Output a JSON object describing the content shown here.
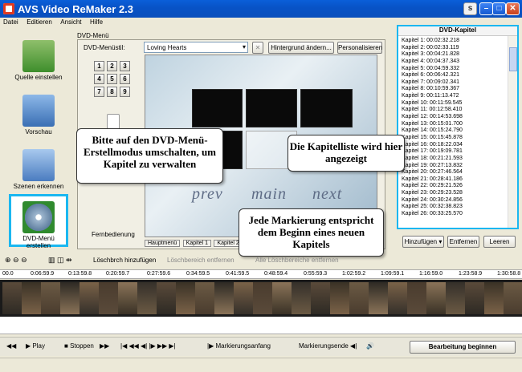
{
  "window": {
    "title": "AVS Video ReMaker 2.3"
  },
  "menu": [
    "Datei",
    "Editieren",
    "Ansicht",
    "Hilfe"
  ],
  "sidebar": {
    "items": [
      {
        "label": "Quelle einstellen"
      },
      {
        "label": "Vorschau"
      },
      {
        "label": "Szenen erkennen"
      },
      {
        "label": "DVD-Menü erstellen"
      }
    ]
  },
  "dvd_menu": {
    "section_label": "DVD-Menü",
    "style_label": "DVD-Menüstil:",
    "style_value": "Loving Hearts",
    "background_button": "Hintergrund ändern...",
    "personalize_button": "Personalisieren",
    "remote_label": "Fernbedienung",
    "numpad": [
      "1",
      "2",
      "3",
      "4",
      "5",
      "6",
      "7",
      "8",
      "9"
    ],
    "nav": [
      "prev",
      "main",
      "next"
    ],
    "tabs": [
      "Hauptmenü",
      "Kapitel 1",
      "Kapitel 2"
    ]
  },
  "chapters": {
    "title": "DVD-Kapitel",
    "items": [
      "Kapitel 1:   00:02:32.218",
      "Kapitel 2:   00:02:33.119",
      "Kapitel 3:   00:04:21.828",
      "Kapitel 4:   00:04:37.343",
      "Kapitel 5:   00:04:59.332",
      "Kapitel 6:   00:06:42.321",
      "Kapitel 7:   00:09:02.341",
      "Kapitel 8:   00:10:59.367",
      "Kapitel 9:   00:11:13.472",
      "Kapitel 10:  00:11:59.545",
      "Kapitel 11:  00:12:58.410",
      "Kapitel 12:  00:14:53.698",
      "Kapitel 13:  00:15:01.700",
      "Kapitel 14:  00:15:24.790",
      "Kapitel 15:  00:15:45.878",
      "Kapitel 16:  00:18:22.034",
      "Kapitel 17:  00:19:09.781",
      "Kapitel 18:  00:21:21.593",
      "Kapitel 19:  00:27:13.832",
      "Kapitel 20:  00:27:46.564",
      "Kapitel 21:  00:28:41.186",
      "Kapitel 22:  00:29:21.526",
      "Kapitel 23:  00:29:23.528",
      "Kapitel 24:  00:30:24.856",
      "Kapitel 25:  00:32:38.823",
      "Kapitel 26:  00:33:25.570"
    ],
    "add_button": "Hinzufügen",
    "remove_button": "Entfernen",
    "clear_button": "Leeren"
  },
  "callouts": {
    "menu_mode": "Bitte auf den DVD-Menü-Erstellmodus umschalten, um Kapitel zu verwalten",
    "chapter_list": "Die Kapitelliste wird hier angezeigt",
    "markers": "Jede Markierung entspricht dem Beginn eines neuen Kapitels"
  },
  "timeline": {
    "add_cut_button": "Löschbrch hinzufügen",
    "remove_cut_button": "Löschbereich entfernen",
    "remove_all_button": "Alle Löschbereiche entfernen",
    "ruler": [
      "00.0",
      "0:06:59.9",
      "0:13:59.8",
      "0:20:59.7",
      "0:27:59.6",
      "0:34:59.5",
      "0:41:59.5",
      "0:48:59.4",
      "0:55:59.3",
      "1:02:59.2",
      "1:09:59.1",
      "1:16:59.0",
      "1:23:58.9",
      "1:30:58.8"
    ]
  },
  "playback": {
    "play_label": "Play",
    "stop_label": "Stoppen",
    "mark_in_label": "Markierungsanfang",
    "mark_out_label": "Markierungsende",
    "start_button": "Bearbeitung beginnen"
  },
  "colors": {
    "highlight": "#1BB7F0",
    "title_blue": "#0A5FD9"
  }
}
